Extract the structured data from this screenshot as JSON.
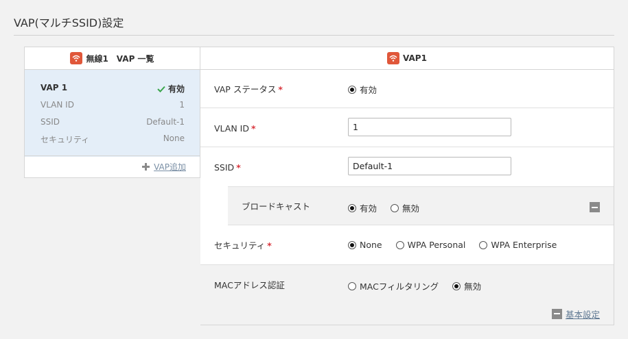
{
  "page": {
    "title": "VAP(マルチSSID)設定"
  },
  "vap_list": {
    "header": "無線1　VAP 一覧",
    "header_icon": "wifi-icon",
    "items": [
      {
        "name": "VAP 1",
        "status": "有効",
        "vlan_label": "VLAN ID",
        "vlan_value": "1",
        "ssid_label": "SSID",
        "ssid_value": "Default-1",
        "security_label": "セキュリティ",
        "security_value": "None"
      }
    ],
    "add_label": "VAP追加"
  },
  "vap_detail": {
    "header": "VAP1",
    "status": {
      "label": "VAP ステータス",
      "required": "*",
      "option": "有効",
      "selected": true
    },
    "vlan_id": {
      "label": "VLAN ID",
      "required": "*",
      "value": "1"
    },
    "ssid": {
      "label": "SSID",
      "required": "*",
      "value": "Default-1"
    },
    "broadcast": {
      "label": "ブロードキャスト",
      "options": [
        "有効",
        "無効"
      ],
      "selected": "有効"
    },
    "security": {
      "label": "セキュリティ",
      "required": "*",
      "options": [
        "None",
        "WPA Personal",
        "WPA Enterprise"
      ],
      "selected": "None"
    },
    "mac_auth": {
      "label": "MACアドレス認証",
      "options": [
        "MACフィルタリング",
        "無効"
      ],
      "selected": "無効"
    },
    "footer_link": "基本設定"
  },
  "colors": {
    "accent_wifi": "#e0573a",
    "required": "#d9363e",
    "link": "#5f7892",
    "selected_card": "#e4eef8",
    "check": "#3aa54b"
  }
}
